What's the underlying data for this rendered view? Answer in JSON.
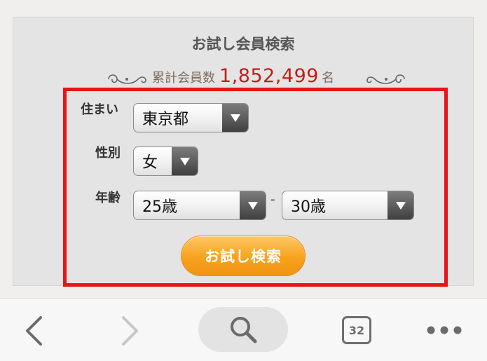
{
  "header": {
    "title": "お試し会員検索",
    "member_label": "累計会員数",
    "member_count": "1,852,499",
    "member_unit": "名"
  },
  "form": {
    "residence_label": "住まい",
    "residence_value": "東京都",
    "gender_label": "性別",
    "gender_value": "女",
    "age_label": "年齢",
    "age_min_value": "25歳",
    "age_separator": "-",
    "age_max_value": "30歳",
    "search_button_label": "お試し検索"
  },
  "toolbar": {
    "back_icon": "chevron-left",
    "forward_icon": "chevron-right",
    "search_icon": "magnifier",
    "tab_count": "32",
    "more_icon": "ellipsis"
  },
  "colors": {
    "highlight_frame": "#e8141a",
    "count_red": "#c01e17",
    "button_orange": "#f7a21e"
  }
}
